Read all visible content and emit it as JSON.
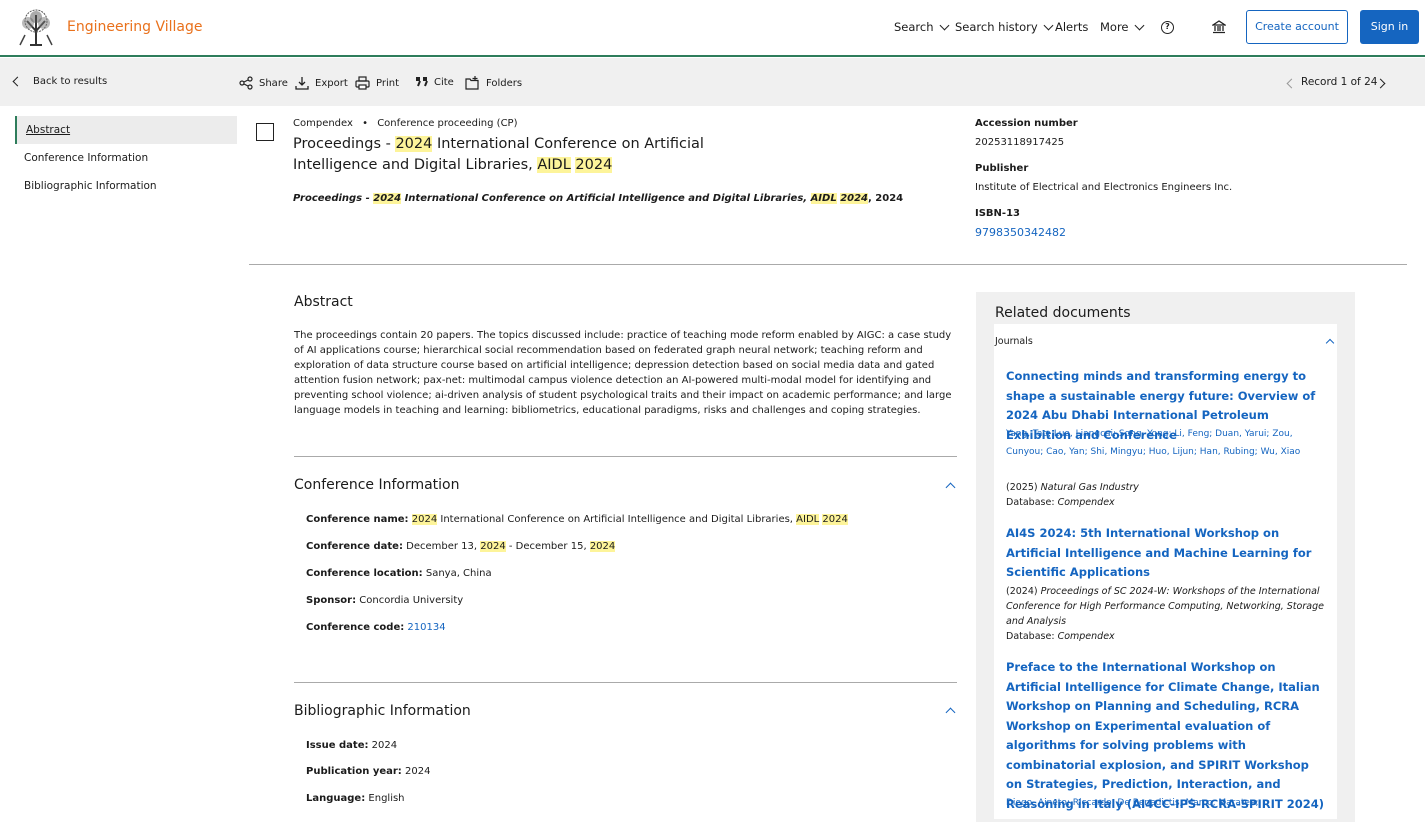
{
  "header": {
    "brand": "Engineering Village",
    "nav": {
      "search": "Search",
      "history": "Search history",
      "alerts": "Alerts",
      "more": "More"
    },
    "help_glyph": "?",
    "create_account": "Create account",
    "sign_in": "Sign in"
  },
  "toolbar": {
    "back": "Back to results",
    "share": "Share",
    "export": "Export",
    "print": "Print",
    "cite": "Cite",
    "folders": "Folders",
    "record": "Record 1 of 24"
  },
  "left_nav": {
    "abstract": "Abstract",
    "conference": "Conference Information",
    "bibliographic": "Bibliographic Information"
  },
  "record": {
    "database": "Compendex",
    "bullet": "•",
    "doc_type": "Conference proceeding (CP)",
    "title": {
      "p1": "Proceedings - ",
      "y1": "2024",
      "p2": " International Conference on Artificial Intelligence and Digital Libraries, ",
      "a": "AIDL",
      "sp": " ",
      "y2": "2024"
    },
    "source": {
      "p1": "Proceedings - ",
      "y1": "2024",
      "p2": " International Conference on Artificial Intelligence and Digital Libraries, ",
      "a": "AIDL",
      "sp": " ",
      "y2": "2024",
      "tail": ", 2024"
    }
  },
  "right_meta": {
    "accession_label": "Accession number",
    "accession_value": "20253118917425",
    "publisher_label": "Publisher",
    "publisher_value": "Institute of Electrical and Electronics Engineers Inc.",
    "isbn_label": "ISBN-13",
    "isbn_value": "9798350342482"
  },
  "abstract": {
    "heading": "Abstract",
    "text": "The proceedings contain 20 papers. The topics discussed include: practice of teaching mode reform enabled by AIGC: a case study of AI applications course; hierarchical social recommendation based on federated graph neural network; teaching reform and exploration of data structure course based on artificial intelligence; depression detection based on social media data and gated attention fusion network; pax-net: multimodal campus violence detection an AI-powered multi-modal model for identifying and preventing school violence; ai-driven analysis of student psychological traits and their impact on academic performance; and large language models in teaching and learning: bibliometrics, educational paradigms, risks and challenges and coping strategies."
  },
  "conference": {
    "heading": "Conference Information",
    "name_label": "Conference name:",
    "name_y1": "2024",
    "name_mid": " International Conference on Artificial Intelligence and Digital Libraries, ",
    "name_a": "AIDL",
    "name_y2": "2024",
    "date_label": "Conference date:",
    "date_p1": "December 13, ",
    "date_y1": "2024",
    "date_p2": " - December 15, ",
    "date_y2": "2024",
    "location_label": "Conference location:",
    "location_value": "Sanya, China",
    "sponsor_label": "Sponsor:",
    "sponsor_value": "Concordia University",
    "code_label": "Conference code:",
    "code_value": "210134"
  },
  "bibliographic": {
    "heading": "Bibliographic Information",
    "issue_label": "Issue date:",
    "issue_value": "2024",
    "pubyear_label": "Publication year:",
    "pubyear_value": "2024",
    "language_label": "Language:",
    "language_value": "English"
  },
  "related": {
    "heading": "Related documents",
    "group": "Journals",
    "db_label": "Database:",
    "items": [
      {
        "title": "Connecting minds and transforming energy to shape a sustainable energy future: Overview of 2024 Abu Dhabi International Petroleum Exhibition and Conference",
        "authors": "Yang, Tao;  Luo, Liangcai;  Song, Yong;   Li, Feng;   Duan, Yarui;  Zou, Cunyou;  Cao, Yan;  Shi, Mingyu;  Huo, Lijun;  Han, Rubing;  Wu, Xiao",
        "year": "(2025) ",
        "journal": "Natural Gas Industry",
        "database": "Compendex"
      },
      {
        "title": "AI4S 2024: 5th International Workshop on Artificial Intelligence and Machine Learning for Scientific Applications",
        "year": "(2024) ",
        "journal": "Proceedings of SC 2024-W: Workshops of the International Conference for High Performance Computing, Networking, Storage and Analysis",
        "database": "Compendex"
      },
      {
        "title": "Preface to the International Workshop on Artificial Intelligence for Climate Change, Italian Workshop on Planning and Scheduling, RCRA Workshop on Experimental evaluation of algorithms for solving problems with combinatorial explosion, and SPIRIT Workshop on Strategies, Prediction, Interaction, and Reasoning in Italy (AI4CC-IPS-RCRA-SPIRIT 2024)",
        "authors": "Diego, Aineto;  Riccardo, De Benedictis;  Marco, Maratea;"
      }
    ]
  }
}
